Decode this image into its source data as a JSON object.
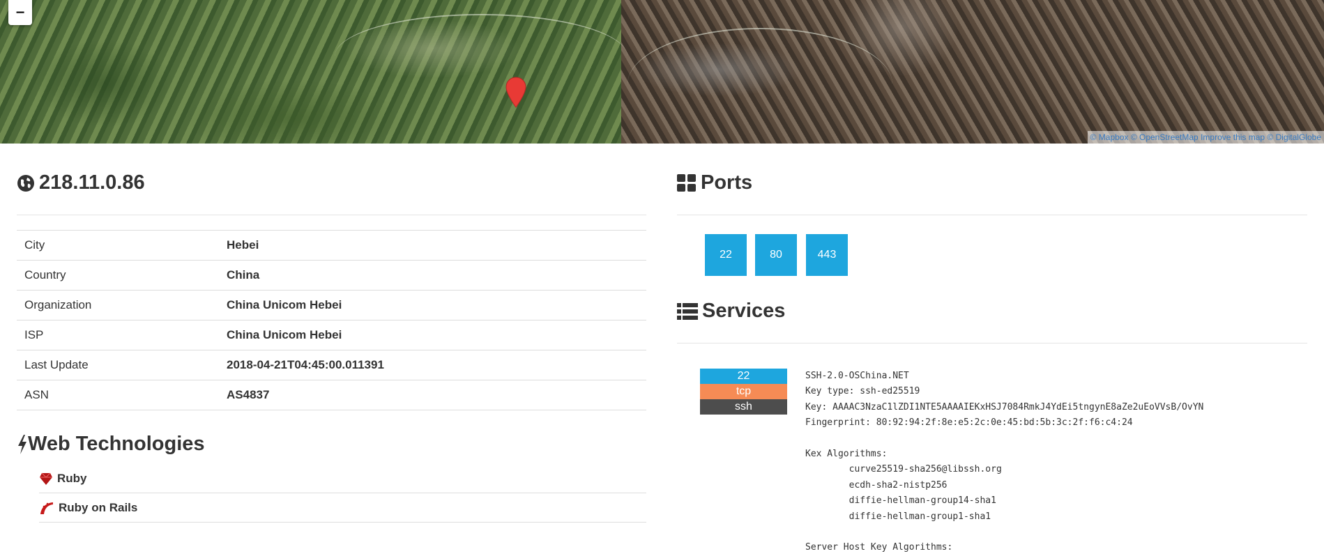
{
  "map": {
    "zoom_out_label": "−",
    "attribution": {
      "mapbox": "© Mapbox",
      "osm": "© OpenStreetMap",
      "improve": "Improve this map",
      "digitalglobe": "© DigitalGlobe"
    }
  },
  "host": {
    "ip": "218.11.0.86",
    "rows": [
      {
        "key": "City",
        "value": "Hebei"
      },
      {
        "key": "Country",
        "value": "China"
      },
      {
        "key": "Organization",
        "value": "China Unicom Hebei"
      },
      {
        "key": "ISP",
        "value": "China Unicom Hebei"
      },
      {
        "key": "Last Update",
        "value": "2018-04-21T04:45:00.011391"
      },
      {
        "key": "ASN",
        "value": "AS4837"
      }
    ]
  },
  "web_technologies": {
    "title": "Web Technologies",
    "items": [
      {
        "name": "Ruby",
        "icon": "ruby-icon"
      },
      {
        "name": "Ruby on Rails",
        "icon": "rails-icon"
      }
    ]
  },
  "ports": {
    "title": "Ports",
    "list": [
      "22",
      "80",
      "443"
    ]
  },
  "services": {
    "title": "Services",
    "service": {
      "port": "22",
      "transport": "tcp",
      "name": "ssh",
      "banner": "SSH-2.0-OSChina.NET\nKey type: ssh-ed25519\nKey: AAAAC3NzaC1lZDI1NTE5AAAAIEKxHSJ7084RmkJ4YdEi5tngynE8aZe2uEoVVsB/OvYN\nFingerprint: 80:92:94:2f:8e:e5:2c:0e:45:bd:5b:3c:2f:f6:c4:24\n\nKex Algorithms:\n\tcurve25519-sha256@libssh.org\n\tecdh-sha2-nistp256\n\tdiffie-hellman-group14-sha1\n\tdiffie-hellman-group1-sha1\n\nServer Host Key Algorithms:"
    }
  },
  "colors": {
    "port_blue": "#1ea6de",
    "tcp_orange": "#f68b55",
    "service_dark": "#4d4d4d",
    "marker_red": "#e83a35"
  }
}
